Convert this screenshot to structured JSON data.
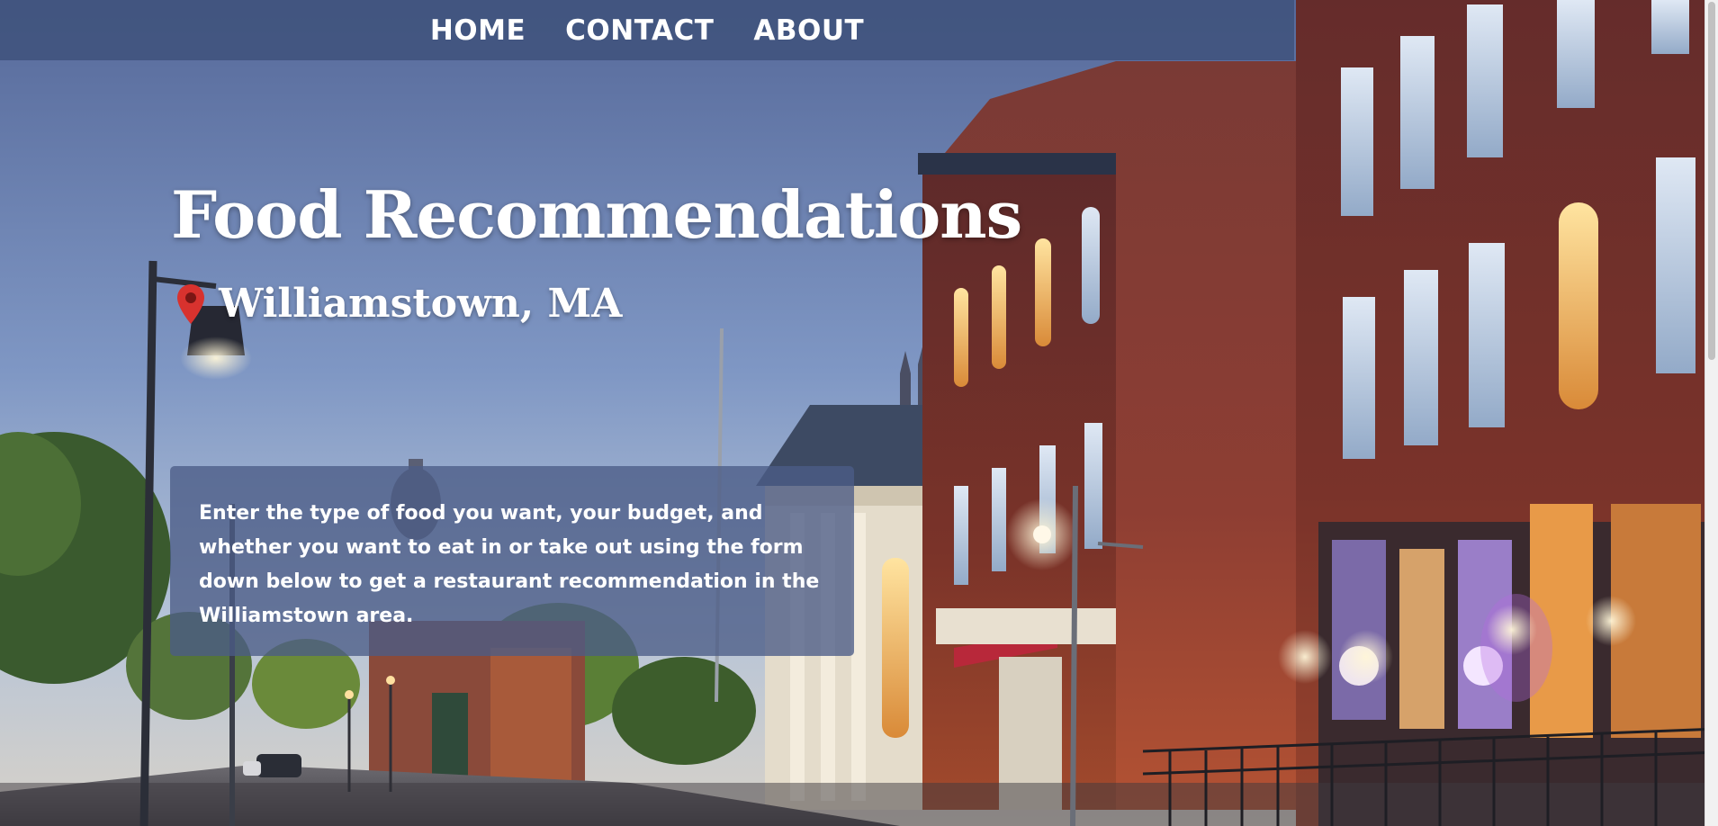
{
  "nav": {
    "links": [
      "HOME",
      "CONTACT",
      "ABOUT"
    ]
  },
  "hero": {
    "title": "Food Recommendations",
    "location": "Williamstown, MA",
    "description": "Enter the type of food you want, your budget, and whether you want to eat in or take out using the form down below to get a restaurant recommendation in the Williamstown area."
  },
  "icons": {
    "location": "map-pin-icon"
  },
  "colors": {
    "nav_background": "#3c5078",
    "info_box_background": "#4b5c87",
    "pin_red": "#d8322e",
    "text": "#ffffff"
  }
}
